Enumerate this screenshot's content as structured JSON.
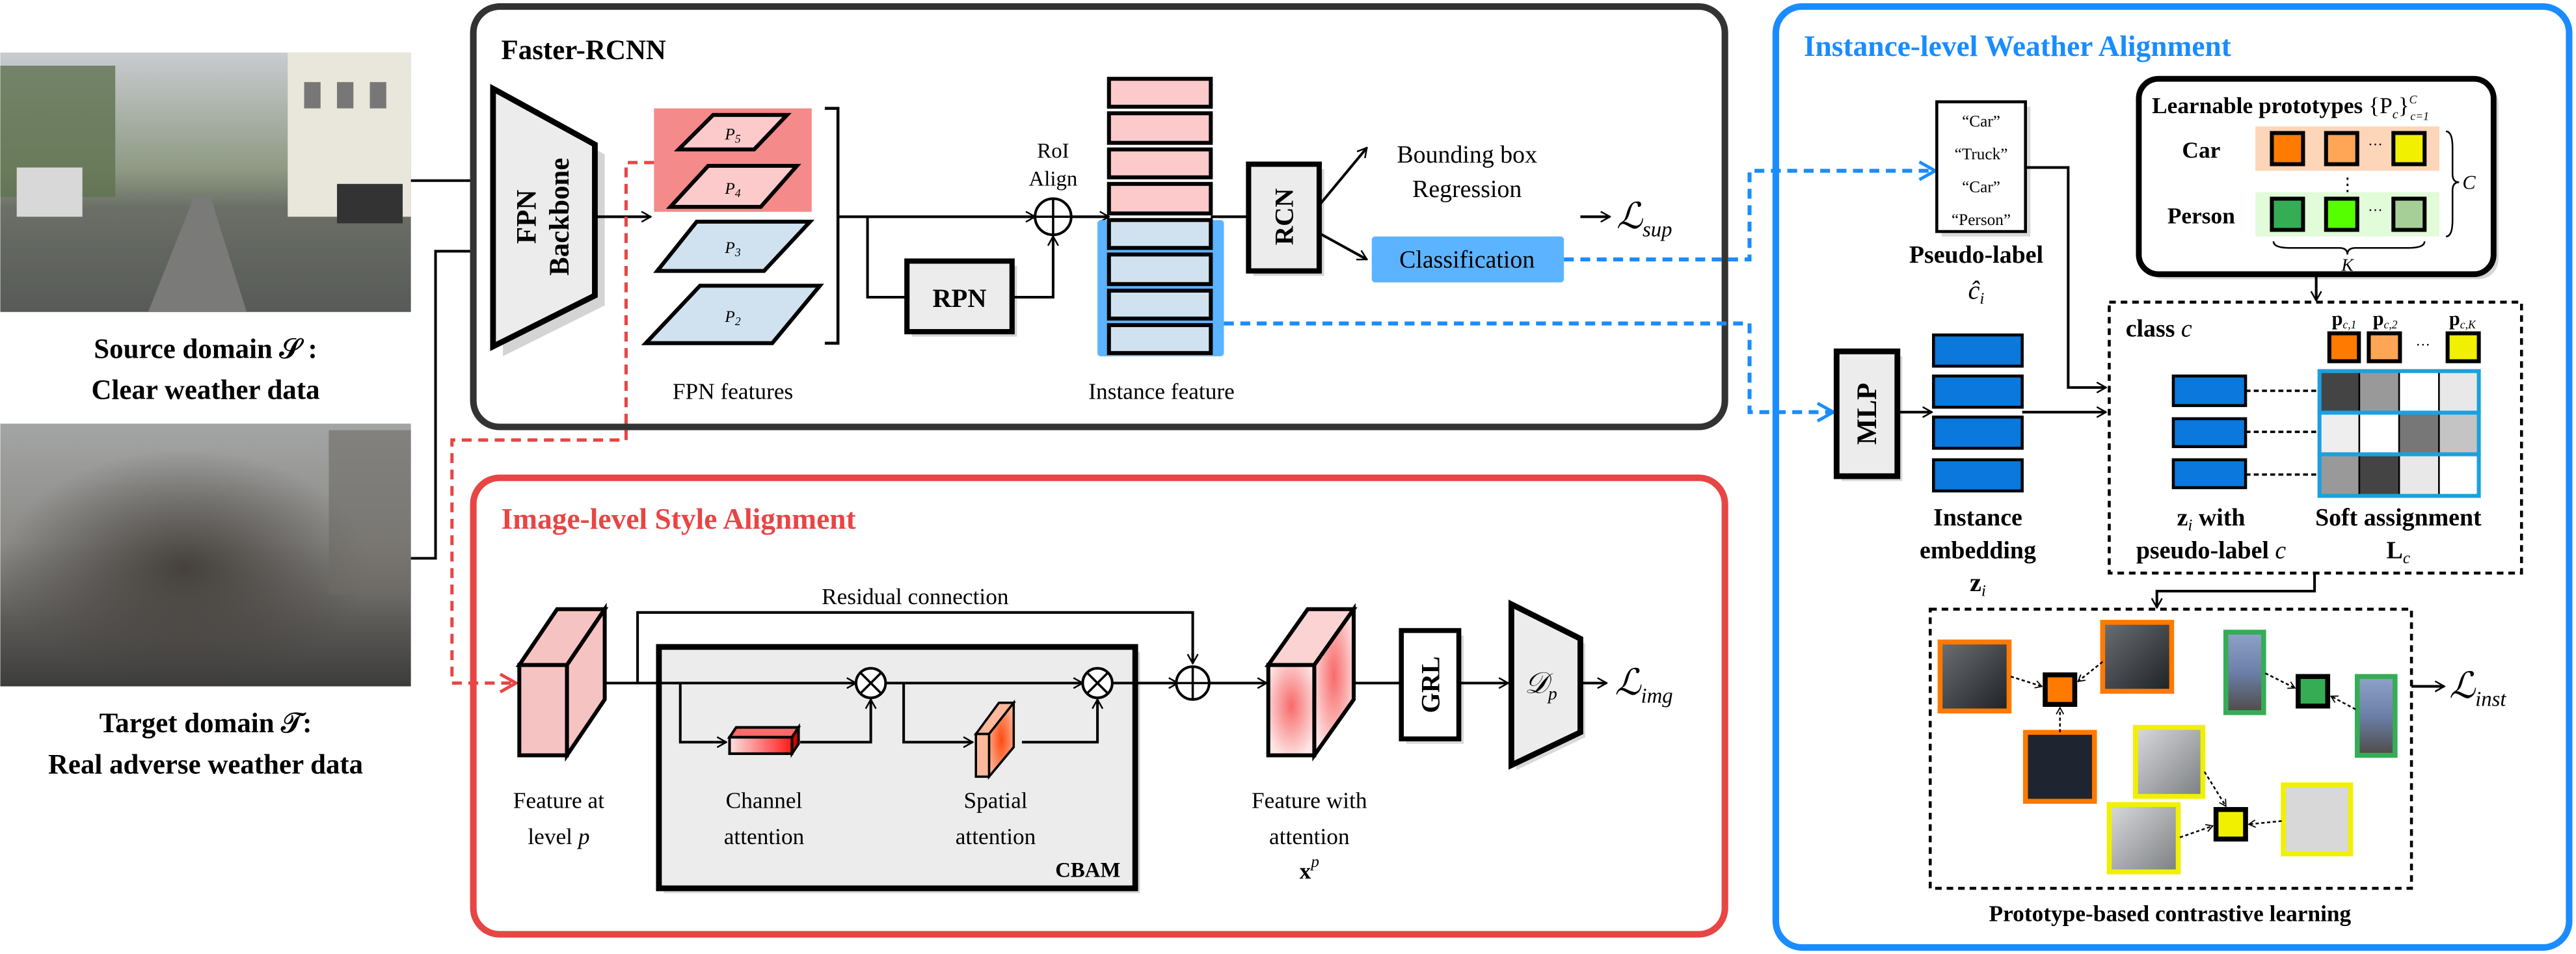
{
  "colors": {
    "faster_rcnn_border": "#333333",
    "image_level_accent": "#e84545",
    "instance_level_accent": "#1a8cff",
    "fpn_high_bg": "#f48a8a",
    "fpn_high_fill": "#fccaca",
    "fpn_low_fill": "#d0e2ef",
    "instance_bg": "#5cb3ff",
    "embedding_fill": "#0a78dc",
    "soft_assignment_border": "#1aa0e0",
    "car_row_bg": "#fdd5b8",
    "person_row_bg": "#e2fbd9",
    "car_prototypes": [
      "#ff7a00",
      "#ffa556",
      "#f0f000"
    ],
    "person_prototypes": [
      "#35ad55",
      "#55ff00",
      "#a6cf98"
    ],
    "soft_assignment_grays": [
      [
        "#444444",
        "#999999",
        "#ffffff",
        "#e8e8e8"
      ],
      [
        "#eeeeee",
        "#ffffff",
        "#777777",
        "#c4c4c4"
      ],
      [
        "#999999",
        "#444444",
        "#e8e8e8",
        "#ffffff"
      ]
    ]
  },
  "inputs": {
    "source_line1": "Source domain 𝒮 :",
    "source_line2": "Clear weather data",
    "target_line1": "Target domain 𝒯:",
    "target_line2": "Real adverse weather data"
  },
  "faster_rcnn": {
    "title": "Faster-RCNN",
    "backbone_line1": "FPN",
    "backbone_line2": "Backbone",
    "fpn_levels": [
      {
        "base": "P",
        "sub": "5"
      },
      {
        "base": "P",
        "sub": "4"
      },
      {
        "base": "P",
        "sub": "3"
      },
      {
        "base": "P",
        "sub": "2"
      }
    ],
    "fpn_features_label": "FPN features",
    "roi_align_line1": "RoI",
    "roi_align_line2": "Align",
    "rpn": "RPN",
    "rcn": "RCN",
    "bbox_line1": "Bounding box",
    "bbox_line2": "Regression",
    "classification": "Classification",
    "instance_feature_label": "Instance feature",
    "loss": {
      "base": "ℒ",
      "sub": "sup"
    }
  },
  "image_level": {
    "title": "Image-level  Style Alignment",
    "residual_label": "Residual connection",
    "feature_line1": "Feature at",
    "feature_line2": "level",
    "feature_var": "p",
    "channel_line1": "Channel",
    "channel_line2": "attention",
    "spatial_line1": "Spatial",
    "spatial_line2": "attention",
    "cbam": "CBAM",
    "attn_feature_line1": "Feature with",
    "attn_feature_line2": "attention",
    "attn_feature_var": {
      "base": "x",
      "sup": "p"
    },
    "grl": "GRL",
    "discriminator": {
      "base": "𝒟",
      "sub": "p"
    },
    "loss": {
      "base": "ℒ",
      "sub": "img"
    }
  },
  "instance_level": {
    "title": "Instance-level Weather Alignment",
    "pseudo_labels": [
      "“Car”",
      "“Truck”",
      "“Car”",
      "“Person”"
    ],
    "pseudo_label_caption": "Pseudo-label",
    "pseudo_label_var": {
      "base": "ĉ",
      "sub": "i"
    },
    "mlp": "MLP",
    "embedding_line1": "Instance",
    "embedding_line2": "embedding",
    "embedding_var": {
      "base": "z",
      "sub": "i"
    },
    "prototypes": {
      "title": "Learnable prototypes",
      "set": {
        "base": "{P",
        "sub": "c",
        "close": "}",
        "sup": "C",
        "sub2": "c=1"
      },
      "rows": [
        {
          "label": "Car"
        },
        {
          "label": "Person"
        }
      ],
      "ellipsis": "···",
      "vdots": "⋮",
      "count_c": "C",
      "count_k": "K"
    },
    "class_box": {
      "title": "class",
      "title_var": "c",
      "proto_labels": [
        {
          "base": "p",
          "sub": "c,1"
        },
        {
          "base": "p",
          "sub": "c,2"
        },
        {
          "base": "p",
          "sub": "c,K"
        }
      ],
      "ellipsis": "···",
      "z_line1_base": "z",
      "z_line1_sub": "i",
      "z_line1_rest": " with",
      "z_line2": "pseudo-label",
      "z_line2_var": "c",
      "soft_line1": "Soft assignment",
      "soft_var": {
        "base": "L",
        "sub": "c"
      }
    },
    "contrastive_label": "Prototype-based contrastive learning",
    "loss": {
      "base": "ℒ",
      "sub": "inst"
    }
  }
}
